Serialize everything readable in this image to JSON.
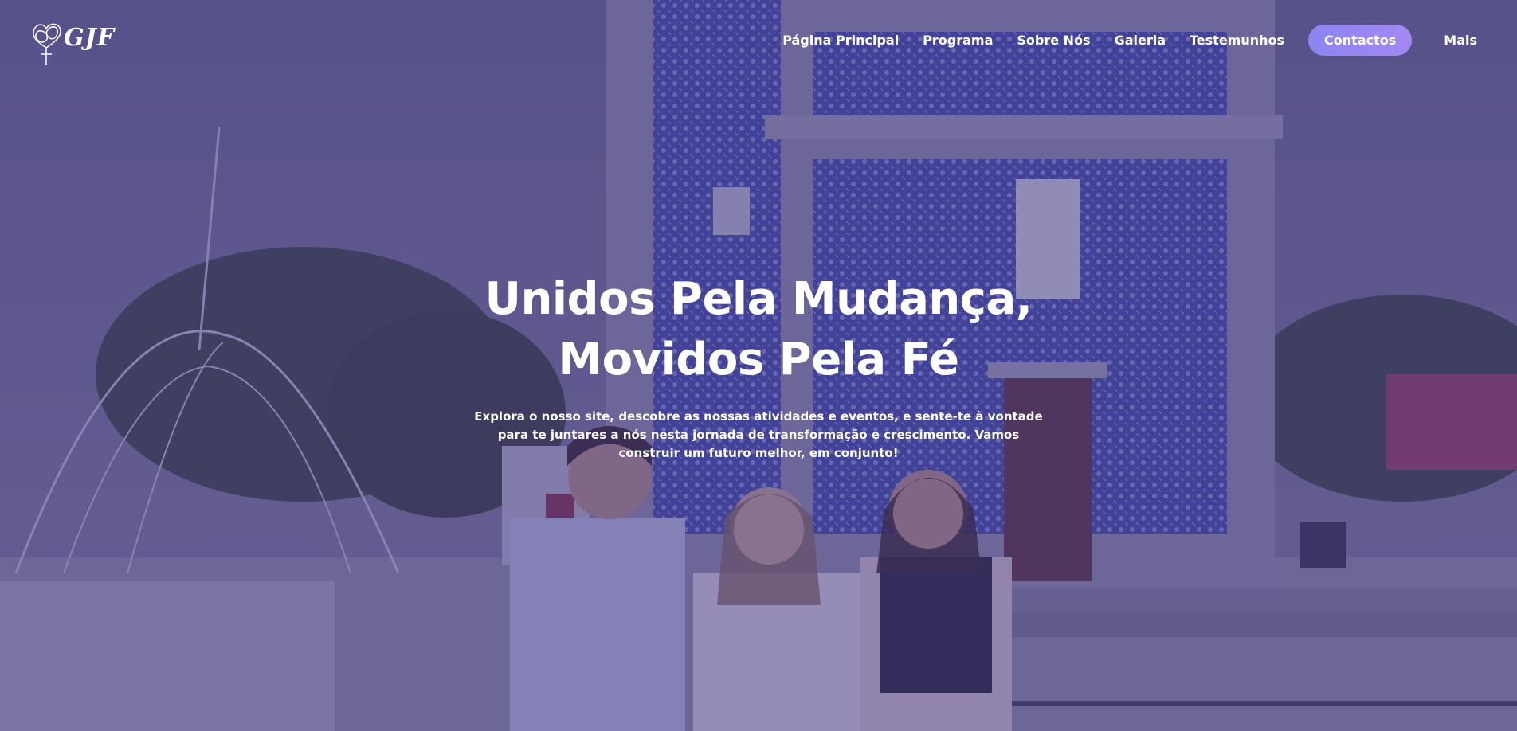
{
  "brand": {
    "logo_text": "GJF"
  },
  "nav": {
    "items": [
      {
        "label": "Página Principal"
      },
      {
        "label": "Programa"
      },
      {
        "label": "Sobre Nós"
      },
      {
        "label": "Galeria"
      },
      {
        "label": "Testemunhos"
      },
      {
        "label": "Contactos"
      },
      {
        "label": "Mais"
      }
    ]
  },
  "hero": {
    "title_line1": "Unidos Pela Mudança,",
    "title_line2": "Movidos Pela Fé",
    "subtitle": "Explora o nosso site, descobre as nossas atividades e eventos, e sente-te à vontade para te juntares a nós nesta jornada de transformação e crescimento. Vamos construir um futuro melhor, em conjunto!"
  },
  "colors": {
    "overlay": "#483e8a",
    "cta_start": "#8a86f3",
    "cta_end": "#a487f1",
    "text": "#ffffff"
  }
}
